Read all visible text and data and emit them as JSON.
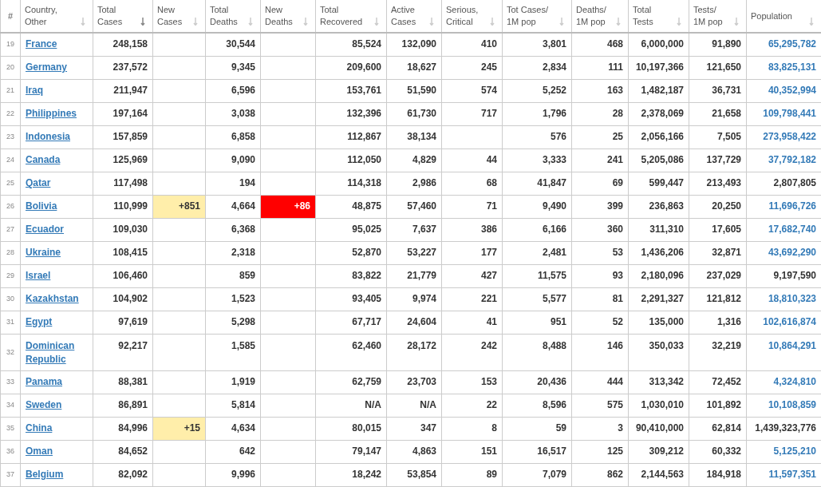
{
  "table": {
    "columns": [
      {
        "label": "#"
      },
      {
        "label": "Country, Other",
        "sorted": false
      },
      {
        "label": "Total Cases",
        "sorted": true
      },
      {
        "label": "New Cases",
        "sorted": false
      },
      {
        "label": "Total Deaths",
        "sorted": false
      },
      {
        "label": "New Deaths",
        "sorted": false
      },
      {
        "label": "Total Recovered",
        "sorted": false
      },
      {
        "label": "Active Cases",
        "sorted": false
      },
      {
        "label": "Serious, Critical",
        "sorted": false
      },
      {
        "label": "Tot Cases/ 1M pop",
        "sorted": false
      },
      {
        "label": "Deaths/ 1M pop",
        "sorted": false
      },
      {
        "label": "Total Tests",
        "sorted": false
      },
      {
        "label": "Tests/ 1M pop",
        "sorted": false
      },
      {
        "label": "Population",
        "sorted": false
      }
    ],
    "rows": [
      {
        "cells": [
          "19",
          "France",
          "248,158",
          "",
          "30,544",
          "",
          "85,524",
          "132,090",
          "410",
          "3,801",
          "468",
          "6,000,000",
          "91,890",
          "65,295,782"
        ],
        "population_link": true
      },
      {
        "cells": [
          "20",
          "Germany",
          "237,572",
          "",
          "9,345",
          "",
          "209,600",
          "18,627",
          "245",
          "2,834",
          "111",
          "10,197,366",
          "121,650",
          "83,825,131"
        ],
        "population_link": true
      },
      {
        "cells": [
          "21",
          "Iraq",
          "211,947",
          "",
          "6,596",
          "",
          "153,761",
          "51,590",
          "574",
          "5,252",
          "163",
          "1,482,187",
          "36,731",
          "40,352,994"
        ],
        "population_link": true
      },
      {
        "cells": [
          "22",
          "Philippines",
          "197,164",
          "",
          "3,038",
          "",
          "132,396",
          "61,730",
          "717",
          "1,796",
          "28",
          "2,378,069",
          "21,658",
          "109,798,441"
        ],
        "population_link": true
      },
      {
        "cells": [
          "23",
          "Indonesia",
          "157,859",
          "",
          "6,858",
          "",
          "112,867",
          "38,134",
          "",
          "576",
          "25",
          "2,056,166",
          "7,505",
          "273,958,422"
        ],
        "population_link": true
      },
      {
        "cells": [
          "24",
          "Canada",
          "125,969",
          "",
          "9,090",
          "",
          "112,050",
          "4,829",
          "44",
          "3,333",
          "241",
          "5,205,086",
          "137,729",
          "37,792,182"
        ],
        "population_link": true
      },
      {
        "cells": [
          "25",
          "Qatar",
          "117,498",
          "",
          "194",
          "",
          "114,318",
          "2,986",
          "68",
          "41,847",
          "69",
          "599,447",
          "213,493",
          "2,807,805"
        ],
        "population_link": false
      },
      {
        "cells": [
          "26",
          "Bolivia",
          "110,999",
          "+851",
          "4,664",
          "+86",
          "48,875",
          "57,460",
          "71",
          "9,490",
          "399",
          "236,863",
          "20,250",
          "11,696,726"
        ],
        "population_link": true
      },
      {
        "cells": [
          "27",
          "Ecuador",
          "109,030",
          "",
          "6,368",
          "",
          "95,025",
          "7,637",
          "386",
          "6,166",
          "360",
          "311,310",
          "17,605",
          "17,682,740"
        ],
        "population_link": true
      },
      {
        "cells": [
          "28",
          "Ukraine",
          "108,415",
          "",
          "2,318",
          "",
          "52,870",
          "53,227",
          "177",
          "2,481",
          "53",
          "1,436,206",
          "32,871",
          "43,692,290"
        ],
        "population_link": true
      },
      {
        "cells": [
          "29",
          "Israel",
          "106,460",
          "",
          "859",
          "",
          "83,822",
          "21,779",
          "427",
          "11,575",
          "93",
          "2,180,096",
          "237,029",
          "9,197,590"
        ],
        "population_link": false
      },
      {
        "cells": [
          "30",
          "Kazakhstan",
          "104,902",
          "",
          "1,523",
          "",
          "93,405",
          "9,974",
          "221",
          "5,577",
          "81",
          "2,291,327",
          "121,812",
          "18,810,323"
        ],
        "population_link": true
      },
      {
        "cells": [
          "31",
          "Egypt",
          "97,619",
          "",
          "5,298",
          "",
          "67,717",
          "24,604",
          "41",
          "951",
          "52",
          "135,000",
          "1,316",
          "102,616,874"
        ],
        "population_link": true
      },
      {
        "cells": [
          "32",
          "Dominican Republic",
          "92,217",
          "",
          "1,585",
          "",
          "62,460",
          "28,172",
          "242",
          "8,488",
          "146",
          "350,033",
          "32,219",
          "10,864,291"
        ],
        "population_link": true
      },
      {
        "cells": [
          "33",
          "Panama",
          "88,381",
          "",
          "1,919",
          "",
          "62,759",
          "23,703",
          "153",
          "20,436",
          "444",
          "313,342",
          "72,452",
          "4,324,810"
        ],
        "population_link": true
      },
      {
        "cells": [
          "34",
          "Sweden",
          "86,891",
          "",
          "5,814",
          "",
          "N/A",
          "N/A",
          "22",
          "8,596",
          "575",
          "1,030,010",
          "101,892",
          "10,108,859"
        ],
        "population_link": true
      },
      {
        "cells": [
          "35",
          "China",
          "84,996",
          "+15",
          "4,634",
          "",
          "80,015",
          "347",
          "8",
          "59",
          "3",
          "90,410,000",
          "62,814",
          "1,439,323,776"
        ],
        "population_link": false
      },
      {
        "cells": [
          "36",
          "Oman",
          "84,652",
          "",
          "642",
          "",
          "79,147",
          "4,863",
          "151",
          "16,517",
          "125",
          "309,212",
          "60,332",
          "5,125,210"
        ],
        "population_link": true
      },
      {
        "cells": [
          "37",
          "Belgium",
          "82,092",
          "",
          "9,996",
          "",
          "18,242",
          "53,854",
          "89",
          "7,079",
          "862",
          "2,144,563",
          "184,918",
          "11,597,351"
        ],
        "population_link": true
      }
    ]
  }
}
